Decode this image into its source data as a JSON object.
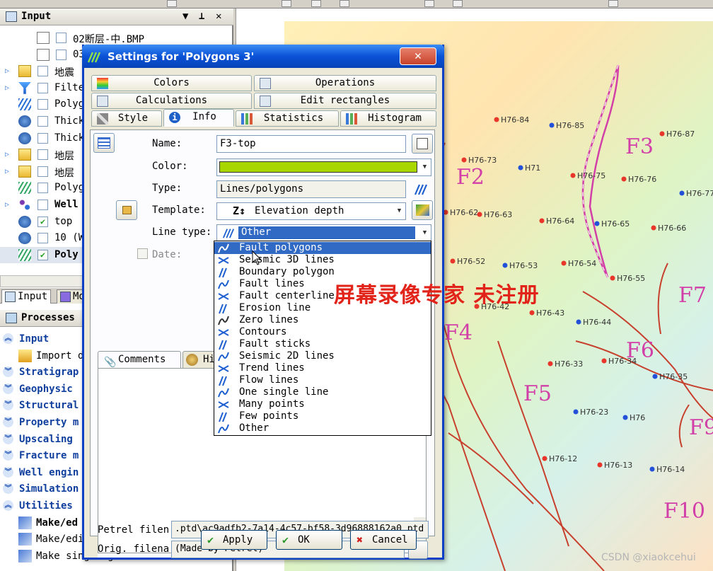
{
  "input_pane": {
    "title": "Input",
    "pin": "▼  ⊥  ✕",
    "items": [
      {
        "label": "02断层-中.BMP",
        "checked": false
      },
      {
        "label": "03",
        "checked": false
      },
      {
        "label": "地震",
        "checked": false
      },
      {
        "label": "Filte",
        "checked": false
      },
      {
        "label": "Polyg",
        "checked": false
      },
      {
        "label": "Thick",
        "checked": false
      },
      {
        "label": "Thick",
        "checked": false
      },
      {
        "label": "地层",
        "checked": false
      },
      {
        "label": "地层",
        "checked": false
      },
      {
        "label": "Polyg",
        "checked": false
      },
      {
        "label": "Well",
        "checked": false
      },
      {
        "label": "top",
        "checked": true
      },
      {
        "label": "10 (W",
        "checked": false
      },
      {
        "label": "Poly",
        "checked": true
      }
    ],
    "tabs": [
      "Input",
      "Mo"
    ]
  },
  "processes_pane": {
    "title": "Processes",
    "items": [
      {
        "label": "Input",
        "kind": "group"
      },
      {
        "label": "Import d",
        "kind": "sub"
      },
      {
        "label": "Stratigrap",
        "kind": "group"
      },
      {
        "label": "Geophysic",
        "kind": "group"
      },
      {
        "label": "Structural",
        "kind": "group"
      },
      {
        "label": "Property m",
        "kind": "group"
      },
      {
        "label": "Upscaling",
        "kind": "group"
      },
      {
        "label": "Fracture m",
        "kind": "group"
      },
      {
        "label": "Well engin",
        "kind": "group"
      },
      {
        "label": "Simulation",
        "kind": "group"
      },
      {
        "label": "Utilities",
        "kind": "group"
      },
      {
        "label": "Make/ed",
        "kind": "sub"
      },
      {
        "label": "Make/edi",
        "kind": "sub"
      },
      {
        "label": "Make single grid",
        "kind": "sub"
      }
    ]
  },
  "dialog": {
    "title": "Settings for 'Polygons 3'",
    "close": "✕",
    "tabs_row1": [
      "Colors",
      "Operations"
    ],
    "tabs_row2": [
      "Calculations",
      "Edit rectangles"
    ],
    "tabs_row3": [
      "Style",
      "Info",
      "Statistics",
      "Histogram"
    ],
    "active_tab": "Info",
    "fields": {
      "name_label": "Name:",
      "name_value": "F3-top",
      "color_label": "Color:",
      "color_value": "#a8d600",
      "type_label": "Type:",
      "type_value": "Lines/polygons",
      "template_label": "Template:",
      "template_value": "Elevation depth",
      "linetype_label": "Line type:",
      "linetype_value": "Other",
      "date_label": "Date:"
    },
    "linetype_options": [
      "Fault polygons",
      "Seismic 3D lines",
      "Boundary polygon",
      "Fault lines",
      "Fault centerline",
      "Erosion line",
      "Zero lines",
      "Contours",
      "Fault sticks",
      "Seismic 2D lines",
      "Trend lines",
      "Flow lines",
      "One single line",
      "Many points",
      "Few points",
      "Other"
    ],
    "linetype_selected_index": 0,
    "comment_tabs": [
      "Comments",
      "His"
    ],
    "petrel_file_label": "Petrel filen",
    "petrel_file_value": ".ptd\\ac9adfb2-7a14-4c57-bf58-3d96888162a0.ptd",
    "orig_file_label": "Orig. filena",
    "orig_file_value": "(Made by Petrel)",
    "buttons": {
      "apply": "Apply",
      "ok": "OK",
      "cancel": "Cancel"
    }
  },
  "map": {
    "wells": [
      "H76-84",
      "H76-85",
      "H76-87",
      "H76-73",
      "H71",
      "H76-75",
      "H76-76",
      "H76-77",
      "H76-62",
      "H76-63",
      "H76-64",
      "H76-65",
      "H76-66",
      "H76-52",
      "H76-53",
      "H76-54",
      "H76-55",
      "H76-42",
      "H76-43",
      "H76-44",
      "H76-33",
      "H76-34",
      "H76-35",
      "H76-23",
      "H76",
      "H76-12",
      "H76-13",
      "H76-14"
    ],
    "faults": [
      "F3",
      "F2",
      "F7",
      "F4",
      "F6",
      "F5",
      "F9",
      "F10"
    ],
    "colors": {
      "well_red": "#e8362a",
      "well_blue": "#2350d8",
      "fault": "#c8402e",
      "fault_label": "#d23fa8"
    }
  },
  "watermark": "屏幕录像专家  未注册",
  "csdn_credit": "CSDN @xiaokcehui"
}
